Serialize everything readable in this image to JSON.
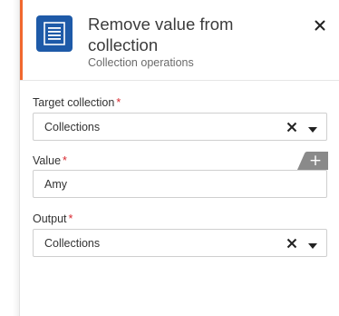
{
  "header": {
    "title": "Remove value from collection",
    "subtitle": "Collection operations",
    "icon": "list-document-icon",
    "accent_color": "#f1682f",
    "icon_bg_color": "#1e5aa8"
  },
  "fields": {
    "target_collection": {
      "label": "Target collection",
      "required_marker": "*",
      "value": "Collections"
    },
    "value": {
      "label": "Value",
      "required_marker": "*",
      "value": "Amy",
      "add_button_glyph": "+"
    },
    "output": {
      "label": "Output",
      "required_marker": "*",
      "value": "Collections"
    }
  }
}
